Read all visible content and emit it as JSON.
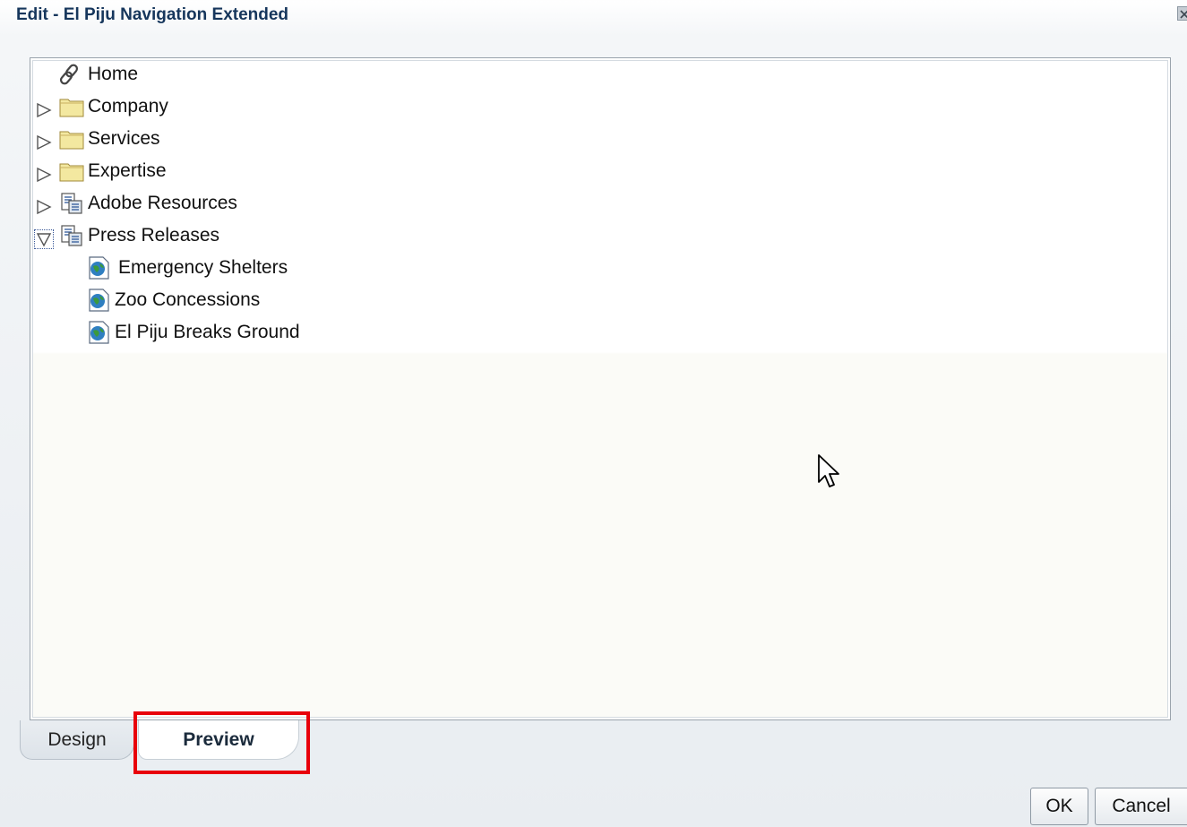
{
  "dialog": {
    "title": "Edit - El Piju Navigation Extended",
    "close_icon": "close-icon"
  },
  "tree": {
    "nodes": [
      {
        "label": "Home",
        "icon": "link-icon",
        "expander": "none"
      },
      {
        "label": "Company",
        "icon": "folder-icon",
        "expander": "collapsed"
      },
      {
        "label": "Services",
        "icon": "folder-icon",
        "expander": "collapsed"
      },
      {
        "label": "Expertise",
        "icon": "folder-icon",
        "expander": "collapsed"
      },
      {
        "label": "Adobe Resources",
        "icon": "content-query-icon",
        "expander": "collapsed"
      },
      {
        "label": "Press Releases",
        "icon": "content-query-icon",
        "expander": "expanded"
      },
      {
        "label": "Emergency Shelters",
        "icon": "web-page-icon",
        "expander": "none"
      },
      {
        "label": "Zoo Concessions",
        "icon": "web-page-icon",
        "expander": "none"
      },
      {
        "label": "El Piju Breaks Ground",
        "icon": "web-page-icon",
        "expander": "none"
      }
    ]
  },
  "tabs": [
    {
      "label": "Design",
      "selected": false
    },
    {
      "label": "Preview",
      "selected": true
    }
  ],
  "buttons": {
    "ok": "OK",
    "cancel": "Cancel"
  },
  "colors": {
    "title": "#16365c",
    "highlight": "#e8000b",
    "folder": "#f3e8a0"
  }
}
